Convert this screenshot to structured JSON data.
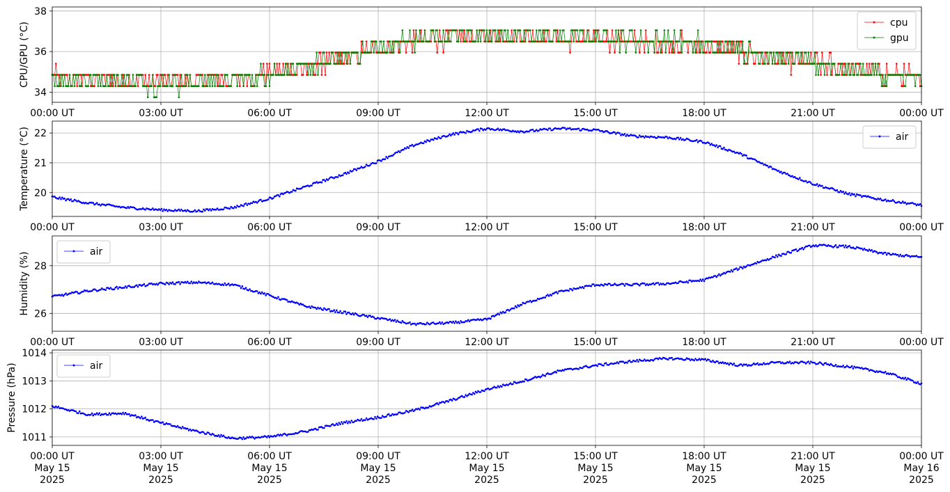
{
  "chart_data": [
    {
      "type": "line",
      "ylabel": "CPU/GPU (°C)",
      "xlim": [
        "2025-05-15T00:00Z",
        "2025-05-16T00:00Z"
      ],
      "ylim": [
        33.5,
        38.2
      ],
      "yticks": [
        34,
        36,
        38
      ],
      "xtick_labels": [
        "00:00 UT",
        "03:00 UT",
        "06:00 UT",
        "09:00 UT",
        "12:00 UT",
        "15:00 UT",
        "18:00 UT",
        "21:00 UT",
        "00:00 UT"
      ],
      "grid": true,
      "legend": "upper right",
      "series": [
        {
          "name": "cpu",
          "color": "#ff0000",
          "marker": "dot",
          "quantized": true,
          "x": [
            0,
            1,
            2,
            3,
            4,
            5,
            6,
            7,
            8,
            9,
            10,
            11,
            12,
            13,
            14,
            15,
            16,
            17,
            18,
            19,
            20,
            21,
            22,
            23,
            24
          ],
          "y": [
            34.8,
            34.7,
            34.6,
            34.5,
            34.6,
            34.7,
            34.9,
            35.2,
            35.6,
            36.1,
            36.5,
            36.7,
            36.7,
            36.7,
            36.6,
            36.6,
            36.5,
            36.4,
            36.3,
            36.0,
            35.6,
            35.4,
            35.2,
            34.9,
            34.7
          ]
        },
        {
          "name": "gpu",
          "color": "#008000",
          "marker": "dot",
          "quantized": true,
          "x": [
            0,
            1,
            2,
            3,
            4,
            5,
            6,
            7,
            8,
            9,
            10,
            11,
            12,
            13,
            14,
            15,
            16,
            17,
            18,
            19,
            20,
            21,
            22,
            23,
            24
          ],
          "y": [
            34.7,
            34.6,
            34.5,
            34.4,
            34.5,
            34.6,
            34.9,
            35.2,
            35.7,
            36.2,
            36.6,
            36.8,
            36.9,
            36.8,
            36.8,
            36.7,
            36.6,
            36.5,
            36.4,
            36.1,
            35.7,
            35.4,
            35.1,
            34.8,
            34.6
          ]
        }
      ]
    },
    {
      "type": "line",
      "ylabel": "Temperature (°C)",
      "xlim": [
        "2025-05-15T00:00Z",
        "2025-05-16T00:00Z"
      ],
      "ylim": [
        19.2,
        22.4
      ],
      "yticks": [
        20,
        21,
        22
      ],
      "xtick_labels": [
        "00:00 UT",
        "03:00 UT",
        "06:00 UT",
        "09:00 UT",
        "12:00 UT",
        "15:00 UT",
        "18:00 UT",
        "21:00 UT",
        "00:00 UT"
      ],
      "grid": true,
      "legend": "upper right",
      "series": [
        {
          "name": "air",
          "color": "#0000ff",
          "marker": "dot",
          "x": [
            0,
            1,
            2,
            3,
            4,
            5,
            6,
            7,
            8,
            9,
            10,
            11,
            12,
            13,
            14,
            15,
            16,
            17,
            18,
            19,
            20,
            21,
            22,
            23,
            24
          ],
          "y": [
            19.85,
            19.65,
            19.5,
            19.42,
            19.38,
            19.5,
            19.8,
            20.2,
            20.6,
            21.05,
            21.6,
            21.95,
            22.15,
            22.05,
            22.15,
            22.1,
            21.9,
            21.85,
            21.7,
            21.3,
            20.75,
            20.3,
            19.95,
            19.75,
            19.58
          ]
        }
      ]
    },
    {
      "type": "line",
      "ylabel": "Humidity (%)",
      "xlim": [
        "2025-05-15T00:00Z",
        "2025-05-16T00:00Z"
      ],
      "ylim": [
        25.25,
        29.25
      ],
      "yticks": [
        26,
        28
      ],
      "xtick_labels": [
        "00:00 UT",
        "03:00 UT",
        "06:00 UT",
        "09:00 UT",
        "12:00 UT",
        "15:00 UT",
        "18:00 UT",
        "21:00 UT",
        "00:00 UT"
      ],
      "grid": true,
      "legend": "upper left",
      "series": [
        {
          "name": "air",
          "color": "#0000ff",
          "marker": "dot",
          "x": [
            0,
            1,
            2,
            3,
            4,
            5,
            6,
            7,
            8,
            9,
            10,
            11,
            12,
            13,
            14,
            15,
            16,
            17,
            18,
            19,
            20,
            21,
            22,
            23,
            24
          ],
          "y": [
            26.7,
            26.95,
            27.1,
            27.25,
            27.3,
            27.2,
            26.75,
            26.3,
            26.05,
            25.8,
            25.55,
            25.6,
            25.75,
            26.4,
            26.9,
            27.2,
            27.2,
            27.25,
            27.4,
            27.9,
            28.4,
            28.85,
            28.8,
            28.5,
            28.35
          ]
        }
      ]
    },
    {
      "type": "line",
      "ylabel": "Pressure (hPa)",
      "xlim": [
        "2025-05-15T00:00Z",
        "2025-05-16T00:00Z"
      ],
      "ylim": [
        1010.7,
        1014.1
      ],
      "yticks": [
        1011,
        1012,
        1013,
        1014
      ],
      "xtick_labels": [
        "00:00 UT\nMay 15\n2025",
        "03:00 UT\nMay 15\n2025",
        "06:00 UT\nMay 15\n2025",
        "09:00 UT\nMay 15\n2025",
        "12:00 UT\nMay 15\n2025",
        "15:00 UT\nMay 15\n2025",
        "18:00 UT\nMay 15\n2025",
        "21:00 UT\nMay 15\n2025",
        "00:00 UT\nMay 16\n2025"
      ],
      "grid": true,
      "legend": "upper left",
      "series": [
        {
          "name": "air",
          "color": "#0000ff",
          "marker": "dot",
          "x": [
            0,
            1,
            2,
            3,
            4,
            5,
            6,
            7,
            8,
            9,
            10,
            11,
            12,
            13,
            14,
            15,
            16,
            17,
            18,
            19,
            20,
            21,
            22,
            23,
            24
          ],
          "y": [
            1012.1,
            1011.8,
            1011.85,
            1011.5,
            1011.2,
            1010.95,
            1011.0,
            1011.2,
            1011.5,
            1011.7,
            1011.95,
            1012.3,
            1012.7,
            1013.0,
            1013.35,
            1013.55,
            1013.7,
            1013.8,
            1013.75,
            1013.55,
            1013.65,
            1013.65,
            1013.5,
            1013.3,
            1012.9
          ]
        }
      ]
    }
  ]
}
